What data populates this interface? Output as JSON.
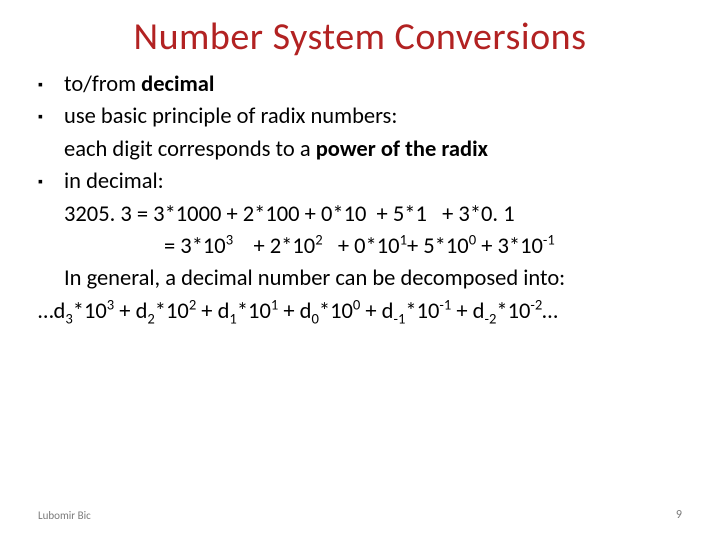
{
  "title": "Number System Conversions",
  "bullets": {
    "b1_pre": "to/from ",
    "b1_bold": "decimal",
    "b2": "use basic principle of radix numbers:",
    "b2_sub_pre": "each digit corresponds to a ",
    "b2_sub_bold": "power of the radix",
    "b3": "in decimal:",
    "eq1": "3205. 3 = 3*1000 + 2*100 + 0*10  + 5*1   + 3*0. 1",
    "eq2": "= 3*10³    + 2*10²   + 0*10¹+ 5*10⁰ + 3*10⁻¹",
    "gen_intro": "In general, a decimal number can be decomposed into:",
    "gen_eq": "…d₃*10³ + d₂*10² + d₁*10¹ + d₀*10⁰ + d₋₁*10⁻¹ + d₋₂*10⁻²…"
  },
  "footer": {
    "author": "Lubomir Bic",
    "page": "9"
  }
}
